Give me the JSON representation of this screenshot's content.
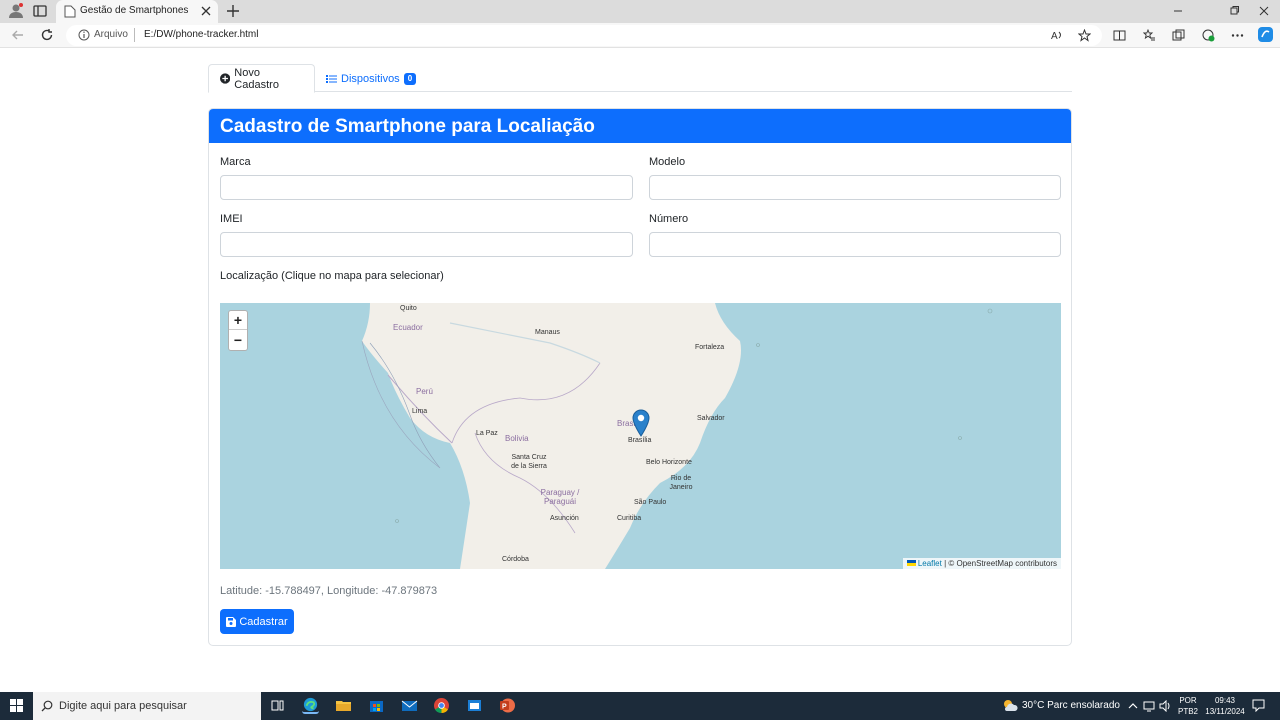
{
  "browser": {
    "tab_title": "Gestão de Smartphones",
    "address_prefix": "Arquivo",
    "url": "E:/DW/phone-tracker.html"
  },
  "nav": {
    "tab_new": "Novo Cadastro",
    "tab_devices": "Dispositivos",
    "devices_count": "0"
  },
  "form": {
    "header": "Cadastro de Smartphone para Localiação",
    "brand_label": "Marca",
    "brand_value": "",
    "model_label": "Modelo",
    "model_value": "",
    "imei_label": "IMEI",
    "imei_value": "",
    "number_label": "Número",
    "number_value": "",
    "location_label": "Localização (Clique no mapa para selecionar)",
    "coords_text": "Latitude: -15.788497, Longitude: -47.879873",
    "submit_label": "Cadastrar"
  },
  "map": {
    "zoom_in": "+",
    "zoom_out": "−",
    "attribution_link": "Leaflet",
    "attribution_rest": "| © OpenStreetMap contributors",
    "cities": [
      "Quito",
      "Manaus",
      "Fortaleza",
      "Lima",
      "Salvador",
      "Brasília",
      "La Paz",
      "Santa Cruz de la Sierra",
      "Belo Horizonte",
      "Rio de Janeiro",
      "São Paulo",
      "Asunción",
      "Curitiba",
      "Córdoba"
    ],
    "countries": [
      "Ecuador",
      "Perú",
      "Bolivia",
      "Paraguay / Paraguái",
      "Brasil"
    ]
  },
  "taskbar": {
    "search_placeholder": "Digite aqui para pesquisar",
    "weather": "30°C  Parc ensolarado",
    "lang_top": "POR",
    "lang_bottom": "PTB2",
    "time": "09:43",
    "date": "13/11/2024"
  },
  "colors": {
    "primary": "#0d6efd",
    "map_water": "#aad3df",
    "map_land": "#f2efe9",
    "taskbar": "#1c2b3a"
  }
}
